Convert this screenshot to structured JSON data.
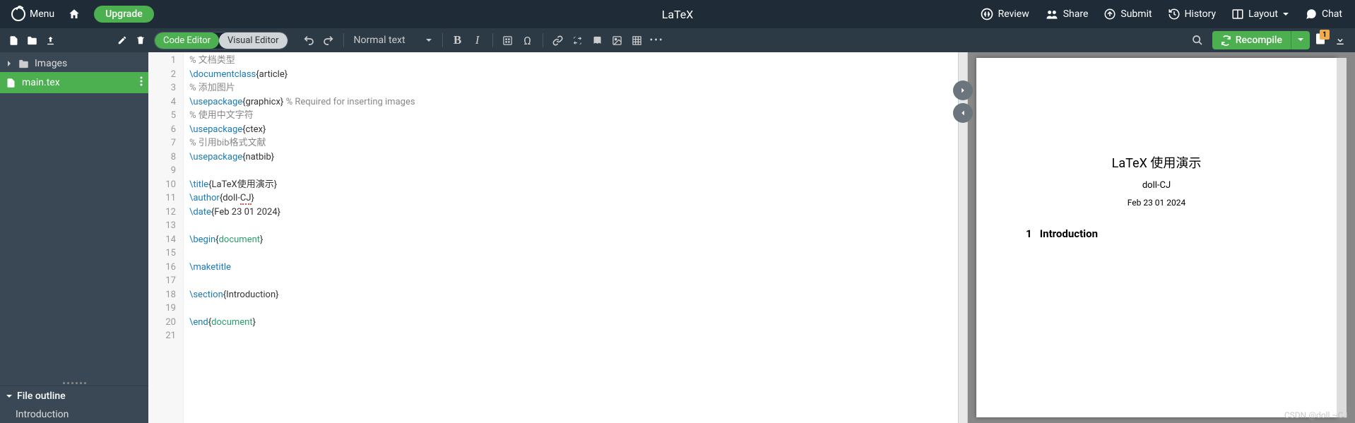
{
  "topbar": {
    "menu_label": "Menu",
    "upgrade_label": "Upgrade",
    "project_title": "LaTeX",
    "review_label": "Review",
    "share_label": "Share",
    "submit_label": "Submit",
    "history_label": "History",
    "layout_label": "Layout",
    "chat_label": "Chat"
  },
  "toolbar": {
    "code_editor_label": "Code Editor",
    "visual_editor_label": "Visual Editor",
    "format_label": "Normal text",
    "recompile_label": "Recompile",
    "log_badge": "1"
  },
  "sidebar": {
    "folder_label": "Images",
    "file_label": "main.tex",
    "outline_header": "File outline",
    "outline_item": "Introduction"
  },
  "code": {
    "lines": [
      {
        "n": "1",
        "t": "comment",
        "text": "% 文档类型"
      },
      {
        "n": "2",
        "t": "cmd",
        "cmd": "\\documentclass",
        "arg": "article"
      },
      {
        "n": "3",
        "t": "comment",
        "text": "% 添加图片"
      },
      {
        "n": "4",
        "t": "cmd_c",
        "cmd": "\\usepackage",
        "arg": "graphicx",
        "trail": " % Required for inserting images"
      },
      {
        "n": "5",
        "t": "comment",
        "text": "% 使用中文字符"
      },
      {
        "n": "6",
        "t": "cmd",
        "cmd": "\\usepackage",
        "arg": "ctex"
      },
      {
        "n": "7",
        "t": "comment",
        "text": "% 引用bib格式文献"
      },
      {
        "n": "8",
        "t": "cmd",
        "cmd": "\\usepackage",
        "arg": "natbib"
      },
      {
        "n": "9",
        "t": "blank"
      },
      {
        "n": "10",
        "t": "cmd",
        "cmd": "\\title",
        "arg": "LaTeX使用演示"
      },
      {
        "n": "11",
        "t": "cmd_u",
        "cmd": "\\author",
        "arg_pre": "doll-",
        "arg_u": "CJ"
      },
      {
        "n": "12",
        "t": "cmd",
        "cmd": "\\date",
        "arg": "Feb 23 01 2024"
      },
      {
        "n": "13",
        "t": "blank"
      },
      {
        "n": "14",
        "t": "env",
        "cmd": "\\begin",
        "arg": "document",
        "fold": true
      },
      {
        "n": "15",
        "t": "blank"
      },
      {
        "n": "16",
        "t": "plain_cmd",
        "cmd": "\\maketitle"
      },
      {
        "n": "17",
        "t": "blank"
      },
      {
        "n": "18",
        "t": "cmd",
        "cmd": "\\section",
        "arg": "Introduction",
        "fold": true
      },
      {
        "n": "19",
        "t": "blank"
      },
      {
        "n": "20",
        "t": "env",
        "cmd": "\\end",
        "arg": "document"
      },
      {
        "n": "21",
        "t": "blank"
      }
    ]
  },
  "pdf": {
    "title": "LaTeX 使用演示",
    "author": "doll-CJ",
    "date": "Feb 23 01 2024",
    "section_num": "1",
    "section_title": "Introduction"
  },
  "watermark": "CSDN @doll ~CJ"
}
